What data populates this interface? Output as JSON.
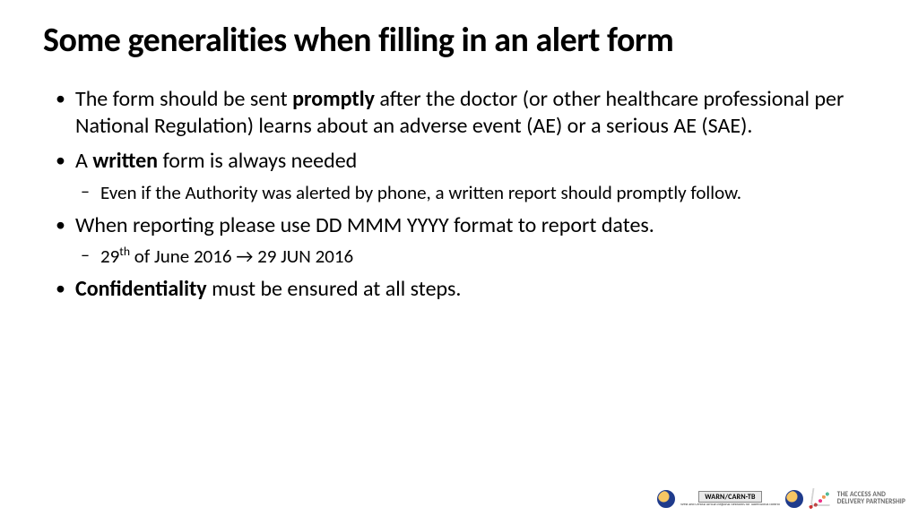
{
  "title": "Some generalities when filling in an alert form",
  "bullets": {
    "b1_pre": "The form should be sent ",
    "b1_bold": "promptly",
    "b1_post": " after the doctor (or other healthcare professional per National Regulation) learns about an adverse event (AE) or a serious AE (SAE).",
    "b2_pre": "A ",
    "b2_bold": "written",
    "b2_post": " form is always needed",
    "b2_sub1": "Even if the Authority was alerted by phone, a written report should promptly follow.",
    "b3": "When reporting please use DD MMM YYYY format to report dates.",
    "b3_sub1_pre": "29",
    "b3_sub1_sup": "th",
    "b3_sub1_mid": " of June 2016 ",
    "b3_sub1_arrow": "→",
    "b3_sub1_post": " 29 JUN 2016",
    "b4_bold": "Confidentiality",
    "b4_post": " must be ensured at all steps."
  },
  "footer": {
    "warn_top": "WARN/CARN-TB",
    "warn_bottom": "West and Central African Regional Networks for Tuberculosis control",
    "adp_line1": "THE ACCESS AND",
    "adp_line2": "DELIVERY PARTNERSHIP"
  }
}
